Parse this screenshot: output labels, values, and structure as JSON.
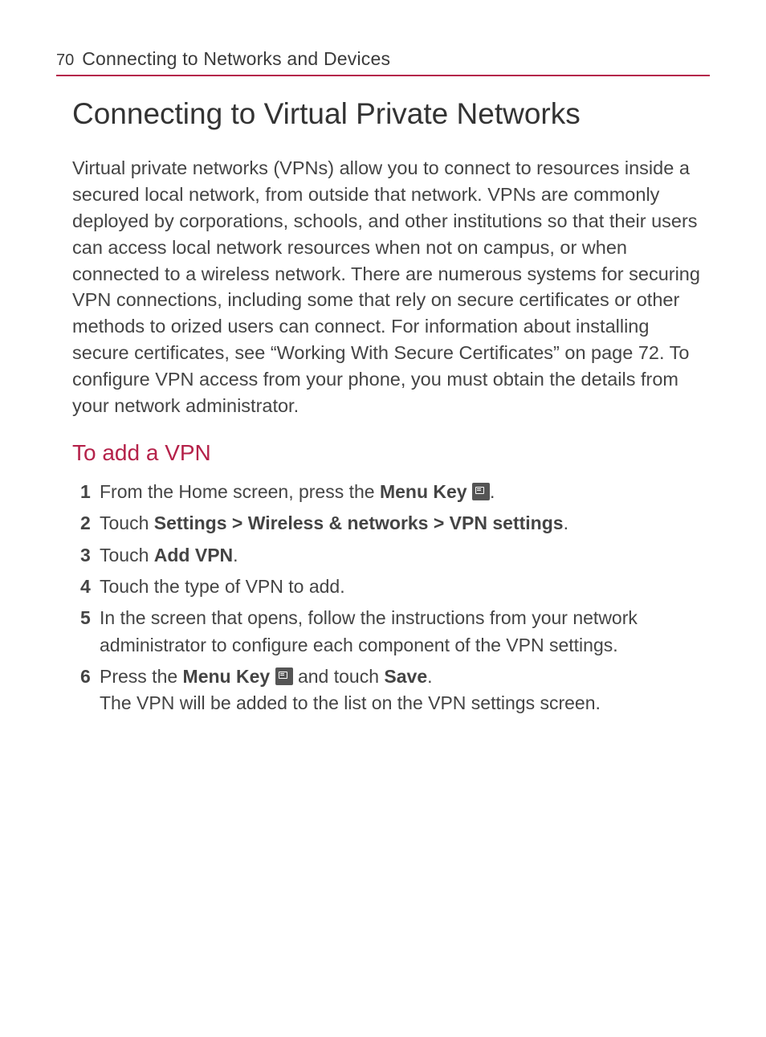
{
  "header": {
    "page_number": "70",
    "title": "Connecting to Networks and Devices"
  },
  "main": {
    "heading": "Connecting to Virtual Private Networks",
    "intro": "Virtual private networks (VPNs) allow you to connect to resources inside a secured local network, from outside that network. VPNs are commonly deployed by corporations, schools, and other institutions so that their users can access local network resources when not on campus, or when connected to a wireless network. There are numerous systems for securing VPN connections, including some that rely on secure certificates or other methods to orized users can connect. For information about installing secure certificates, see “Working With Secure Certificates” on page 72. To configure VPN access from your phone, you must obtain the details from your network administrator.",
    "subheading": "To add a VPN",
    "steps": {
      "s1_a": "From the Home screen, press the ",
      "s1_b": "Menu Key",
      "s1_c": ".",
      "s2_a": "Touch ",
      "s2_b": "Settings > Wireless & networks > VPN settings",
      "s2_c": ".",
      "s3_a": "Touch ",
      "s3_b": "Add VPN",
      "s3_c": ".",
      "s4": "Touch the type of VPN to add.",
      "s5": "In the screen that opens, follow the instructions from your network administrator to configure each component of the VPN settings.",
      "s6_a": "Press the ",
      "s6_b": "Menu Key",
      "s6_c": " and touch ",
      "s6_d": "Save",
      "s6_e": ".",
      "s6_f": "The VPN will be added to the list on the VPN settings screen."
    },
    "step_numbers": {
      "n1": "1",
      "n2": "2",
      "n3": "3",
      "n4": "4",
      "n5": "5",
      "n6": "6"
    }
  }
}
